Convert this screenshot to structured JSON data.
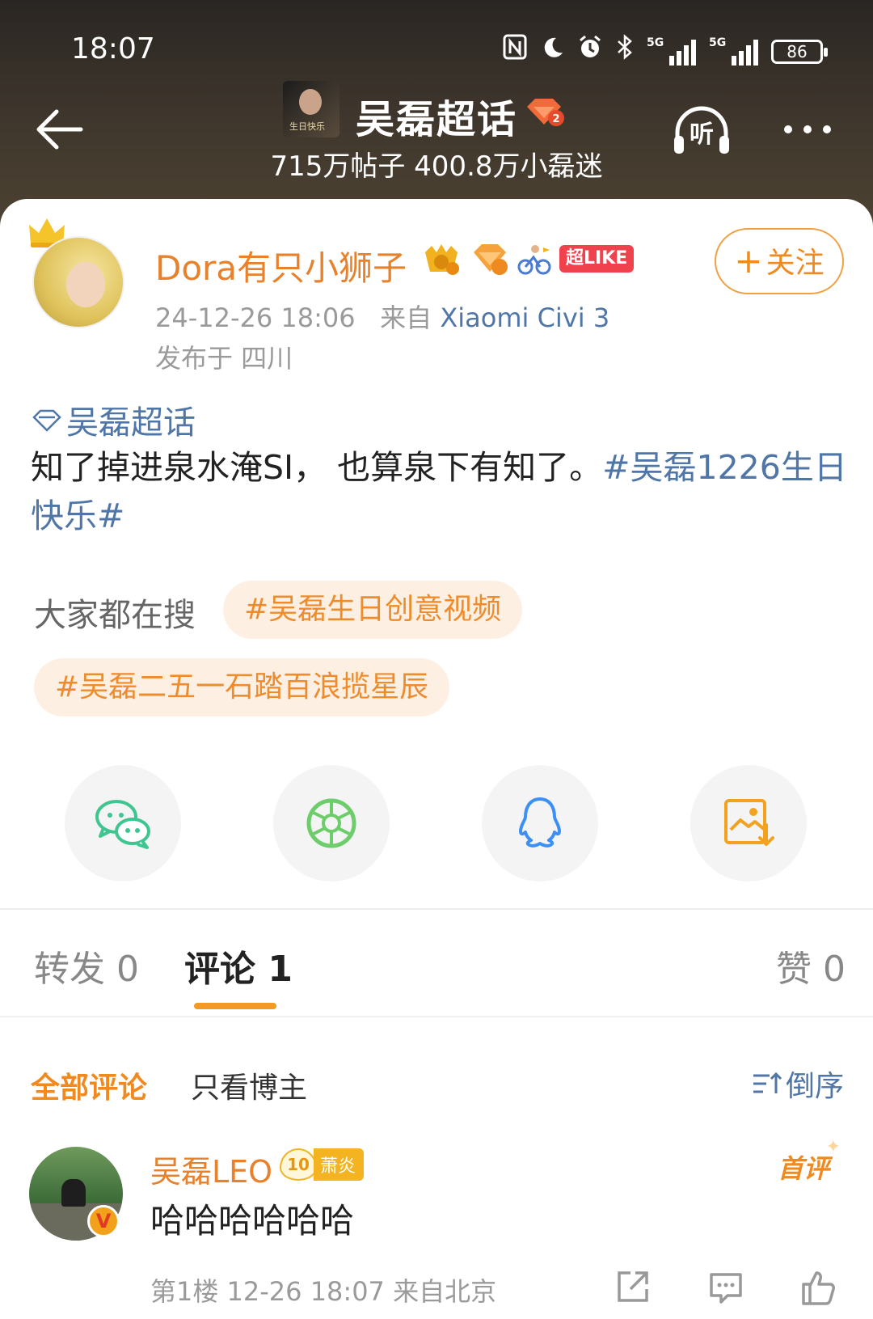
{
  "status_bar": {
    "time": "18:07",
    "network1": "5G",
    "network2": "5G",
    "battery": "86"
  },
  "header": {
    "title": "吴磊超话",
    "thumb_text": "生日快乐",
    "subtitle": "715万帖子 400.8万小磊迷",
    "listen_label": "听"
  },
  "post": {
    "author": "Dora有只小狮子",
    "super_like_badge": "超LIKE",
    "follow_label": "关注",
    "timestamp": "24-12-26 18:06",
    "source_prefix": "来自",
    "device": "Xiaomi Civi 3",
    "location": "发布于 四川",
    "topic_link": "吴磊超话",
    "text_plain": "知了掉进泉水淹SI， 也算泉下有知了。",
    "text_tag": "#吴磊1226生日快乐#",
    "search_label": "大家都在搜",
    "search_chips": [
      "#吴磊生日创意视频",
      "#吴磊二五一石踏百浪揽星辰"
    ]
  },
  "share_icons": [
    "wechat-icon",
    "moments-icon",
    "qq-icon",
    "save-image-icon"
  ],
  "colors": {
    "accent_orange": "#f08a1e",
    "link_blue": "#5076a8",
    "chip_bg": "#fdf0e3",
    "super_like_red": "#f0424d"
  },
  "tabs": {
    "repost": "转发 0",
    "comment": "评论 1",
    "like": "赞 0"
  },
  "comment_filters": {
    "all": "全部评论",
    "op_only": "只看博主",
    "sort": "倒序"
  },
  "comment": {
    "author": "吴磊LEO",
    "level": "10",
    "badge_name": "萧炎",
    "verified": "V",
    "first_label": "首评",
    "text": "哈哈哈哈哈哈",
    "meta": "第1楼 12-26 18:07 来自北京"
  }
}
